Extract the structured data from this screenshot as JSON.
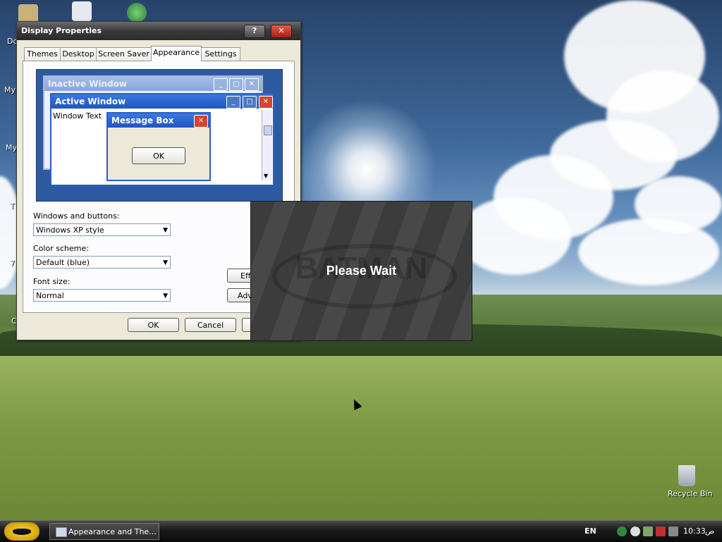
{
  "desktop": {
    "icons": [
      {
        "label": "Do",
        "name": "desktop-icon-documents"
      },
      {
        "label": "My",
        "name": "desktop-icon-my-computer"
      },
      {
        "label": "My",
        "name": "desktop-icon-my-network"
      },
      {
        "label": "T",
        "name": "desktop-icon-t"
      },
      {
        "label": "7",
        "name": "desktop-icon-7"
      },
      {
        "label": "C",
        "name": "desktop-icon-c"
      }
    ],
    "recycle_bin": "Recycle Bin"
  },
  "display_properties": {
    "title": "Display Properties",
    "help_button": "?",
    "close_button": "✕",
    "tabs": [
      "Themes",
      "Desktop",
      "Screen Saver",
      "Appearance",
      "Settings"
    ],
    "active_tab": "Appearance",
    "preview": {
      "inactive_window": "Inactive Window",
      "active_window": "Active Window",
      "window_text": "Window Text",
      "message_box": "Message Box",
      "ok": "OK"
    },
    "windows_buttons_label": "Windows and buttons:",
    "windows_buttons_value": "Windows XP style",
    "color_scheme_label": "Color scheme:",
    "color_scheme_value": "Default (blue)",
    "font_size_label": "Font size:",
    "font_size_value": "Normal",
    "effects_button": "Effe",
    "advanced_button": "Adv",
    "ok_button": "OK",
    "cancel_button": "Cancel"
  },
  "overlay": {
    "message": "Please Wait",
    "watermark": "BATMAN"
  },
  "taskbar": {
    "task_title": "Appearance and The...",
    "language": "EN",
    "time": "10:33",
    "ampm": "ص"
  }
}
